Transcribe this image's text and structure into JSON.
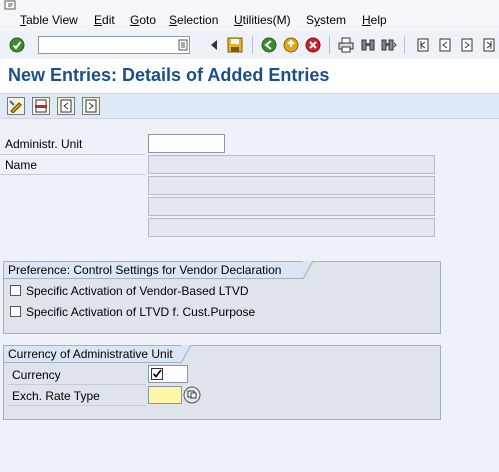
{
  "menu": {
    "items": [
      {
        "label": "Table View",
        "underline": "T"
      },
      {
        "label": "Edit",
        "underline": "E"
      },
      {
        "label": "Goto",
        "underline": "G"
      },
      {
        "label": "Selection",
        "underline": "S"
      },
      {
        "label": "Utilities(M)",
        "underline": "U"
      },
      {
        "label": "System",
        "underline": "y"
      },
      {
        "label": "Help",
        "underline": "H"
      }
    ]
  },
  "toolbar": {
    "command_value": "",
    "icons": [
      "enter-icon",
      "save-icon",
      "back-icon",
      "exit-icon",
      "cancel-icon",
      "print-icon",
      "find-icon",
      "find-next-icon",
      "first-page-icon",
      "previous-page-icon",
      "next-page-icon",
      "last-page-icon"
    ]
  },
  "title": "New Entries: Details of Added Entries",
  "app_toolbar": {
    "icons": [
      "change-display-icon",
      "delete-icon",
      "previous-entry-icon",
      "next-entry-icon"
    ]
  },
  "form": {
    "admin_unit_label": "Administr. Unit",
    "admin_unit_value": "",
    "name_label": "Name"
  },
  "group_preference": {
    "title": "Preference: Control Settings for Vendor Declaration",
    "checkbox1_label": "Specific Activation of Vendor-Based LTVD",
    "checkbox2_label": "Specific Activation of LTVD f. Cust.Purpose"
  },
  "group_currency": {
    "title": "Currency of Administrative Unit",
    "currency_label": "Currency",
    "exch_rate_label": "Exch. Rate Type",
    "exch_rate_value": ""
  },
  "colors": {
    "title": "#1b4e8c",
    "required_field": "#fdf6a7",
    "app_toolbar": "#dfe8f5"
  }
}
